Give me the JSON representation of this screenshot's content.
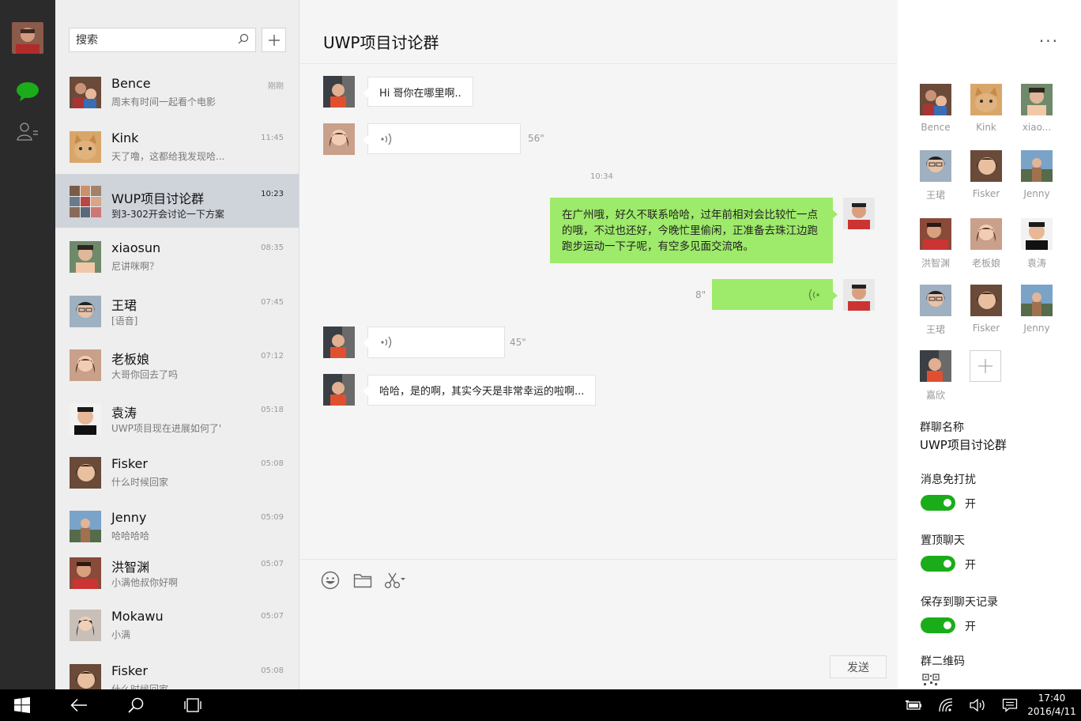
{
  "search": {
    "placeholder": "搜索"
  },
  "conversations": [
    {
      "name": "Bence",
      "preview": "周末有时间一起看个电影",
      "time": "刚刚"
    },
    {
      "name": "Kink",
      "preview": "天了噜，这都给我发现哈...",
      "time": "11:45"
    },
    {
      "name": "WUP项目讨论群",
      "preview": "到3-302开会讨论一下方案",
      "time": "10:23"
    },
    {
      "name": "xiaosun",
      "preview": "尼讲咪啊？",
      "time": "08:35"
    },
    {
      "name": "王珺",
      "preview": "[语音]",
      "time": "07:45"
    },
    {
      "name": "老板娘",
      "preview": "大哥你回去了吗",
      "time": "07:12"
    },
    {
      "name": "袁涛",
      "preview": "UWP项目现在进展如何了'",
      "time": "05:18"
    },
    {
      "name": "Fisker",
      "preview": "什么时候回家",
      "time": "05:08"
    },
    {
      "name": "Jenny",
      "preview": "哈哈哈哈",
      "time": "05:09"
    },
    {
      "name": "洪智渊",
      "preview": "小满他叔你好啊",
      "time": "05:07"
    },
    {
      "name": "Mokawu",
      "preview": "小满",
      "time": "05:07"
    },
    {
      "name": "Fisker",
      "preview": "什么时候回家",
      "time": "05:08"
    }
  ],
  "chat": {
    "title": "UWP项目讨论群",
    "timestamp": "10:34",
    "messages": [
      {
        "text": "Hi 哥你在哪里啊.."
      },
      {
        "duration": "56\""
      },
      {
        "text": "在广州哦，好久不联系哈哈，过年前相对会比较忙一点的哦，不过也还好，今晚忙里偷闲，正准备去珠江边跑跑步运动一下子呢，有空多见面交流咯。"
      },
      {
        "duration": "8\""
      },
      {
        "duration": "45\""
      },
      {
        "text": "哈哈，是的啊，其实今天是非常幸运的啦啊..."
      }
    ],
    "send_label": "发送"
  },
  "panel": {
    "more": "···",
    "members": [
      "Bence",
      "Kink",
      "xiao...",
      "王珺",
      "Fisker",
      "Jenny",
      "洪智渊",
      "老板娘",
      "袁涛",
      "王珺",
      "Fisker",
      "Jenny",
      "嘉欣"
    ],
    "group_name_label": "群聊名称",
    "group_name": "UWP项目讨论群",
    "mute_label": "消息免打扰",
    "mute_state": "开",
    "pin_label": "置顶聊天",
    "pin_state": "开",
    "save_label": "保存到聊天记录",
    "save_state": "开",
    "qr_label": "群二维码"
  },
  "taskbar": {
    "time": "17:40",
    "date": "2016/4/11"
  },
  "colors": {
    "accent": "#1aad19",
    "bubble_self": "#9eea6a",
    "rail": "#2b2b2b"
  }
}
